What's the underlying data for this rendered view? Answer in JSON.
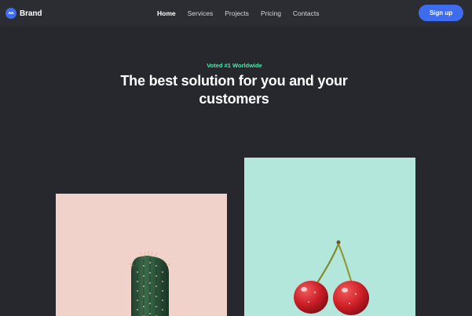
{
  "brand": {
    "name": "Brand",
    "logo_icon": "brand-logo-icon"
  },
  "nav": {
    "links": [
      {
        "label": "Home",
        "active": true
      },
      {
        "label": "Services",
        "active": false
      },
      {
        "label": "Projects",
        "active": false
      },
      {
        "label": "Pricing",
        "active": false
      },
      {
        "label": "Contacts",
        "active": false
      }
    ],
    "signup_label": "Sign up"
  },
  "hero": {
    "badge": "Voted #1 Worldwide",
    "title": "The best solution for you and your customers"
  },
  "gallery": {
    "items": [
      {
        "subject": "cactus",
        "background": "#f0d2cb"
      },
      {
        "subject": "cherries",
        "background": "#b3e7dc"
      }
    ]
  },
  "colors": {
    "background": "#27272e",
    "navbar": "#2c2c33",
    "accent": "#3d6cf0",
    "badge": "#4ee6a6",
    "text": "#ffffff"
  }
}
